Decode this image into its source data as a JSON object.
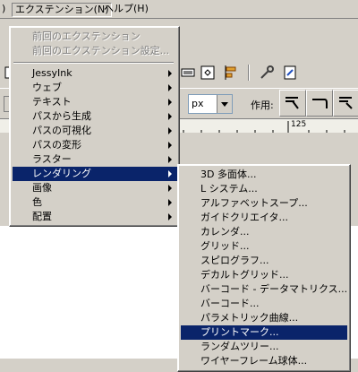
{
  "menubar": {
    "edge_label": ")",
    "extensions_label": "エクステンション(N)",
    "help_label": "ヘルプ(H)"
  },
  "controlbar": {
    "unit_value": "px",
    "action_label": "作用:"
  },
  "ruler": {
    "tick_label": "125"
  },
  "extensions_menu": {
    "items": [
      {
        "label": "前回のエクステンション"
      },
      {
        "label": "前回のエクステンション設定..."
      },
      {
        "label": "JessyInk"
      },
      {
        "label": "ウェブ"
      },
      {
        "label": "テキスト"
      },
      {
        "label": "パスから生成"
      },
      {
        "label": "パスの可視化"
      },
      {
        "label": "パスの変形"
      },
      {
        "label": "ラスター"
      },
      {
        "label": "レンダリング"
      },
      {
        "label": "画像"
      },
      {
        "label": "色"
      },
      {
        "label": "配置"
      }
    ]
  },
  "render_submenu": {
    "items": [
      {
        "label": "3D 多面体..."
      },
      {
        "label": "L システム..."
      },
      {
        "label": "アルファベットスープ..."
      },
      {
        "label": "ガイドクリエイタ..."
      },
      {
        "label": "カレンダ..."
      },
      {
        "label": "グリッド..."
      },
      {
        "label": "スピログラフ..."
      },
      {
        "label": "デカルトグリッド..."
      },
      {
        "label": "バーコード - データマトリクス..."
      },
      {
        "label": "バーコード..."
      },
      {
        "label": "パラメトリック曲線..."
      },
      {
        "label": "プリントマーク..."
      },
      {
        "label": "ランダムツリー..."
      },
      {
        "label": "ワイヤーフレーム球体..."
      }
    ]
  },
  "colors": {
    "menu_bg": "#d4d0c8",
    "highlight": "#0a246a"
  }
}
